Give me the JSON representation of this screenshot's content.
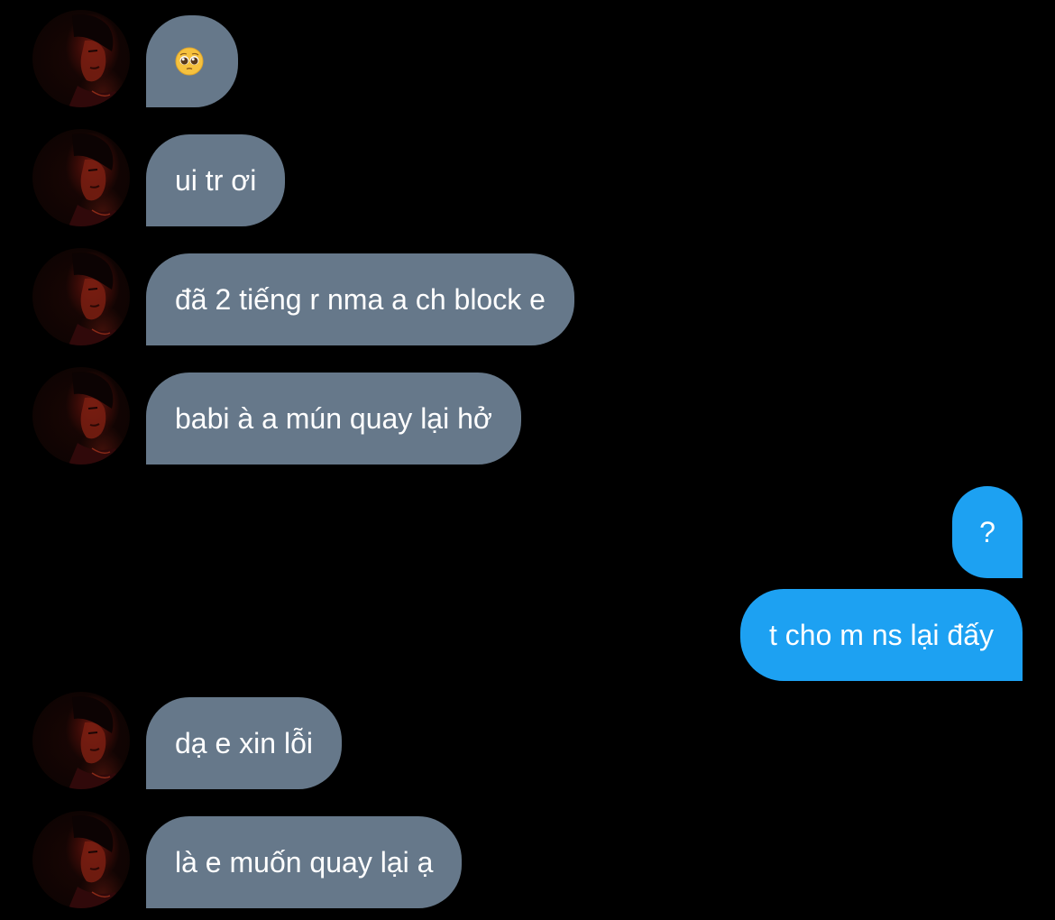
{
  "conversation": {
    "colors": {
      "background": "#000000",
      "incoming_bubble": "#66788a",
      "outgoing_bubble": "#1da1f2",
      "text": "#ffffff"
    },
    "messages": [
      {
        "from": "them",
        "text": "",
        "emoji": "pleading-face-emoji"
      },
      {
        "from": "them",
        "text": "ui tr ơi"
      },
      {
        "from": "them",
        "text": "đã 2 tiếng r nma a ch block e"
      },
      {
        "from": "them",
        "text": "babi à a mún quay lại hở"
      },
      {
        "from": "me",
        "text": "?"
      },
      {
        "from": "me",
        "text": "t cho m ns lại đấy"
      },
      {
        "from": "them",
        "text": "dạ e xin lỗi"
      },
      {
        "from": "them",
        "text": "là e muốn quay lại ạ"
      }
    ]
  }
}
